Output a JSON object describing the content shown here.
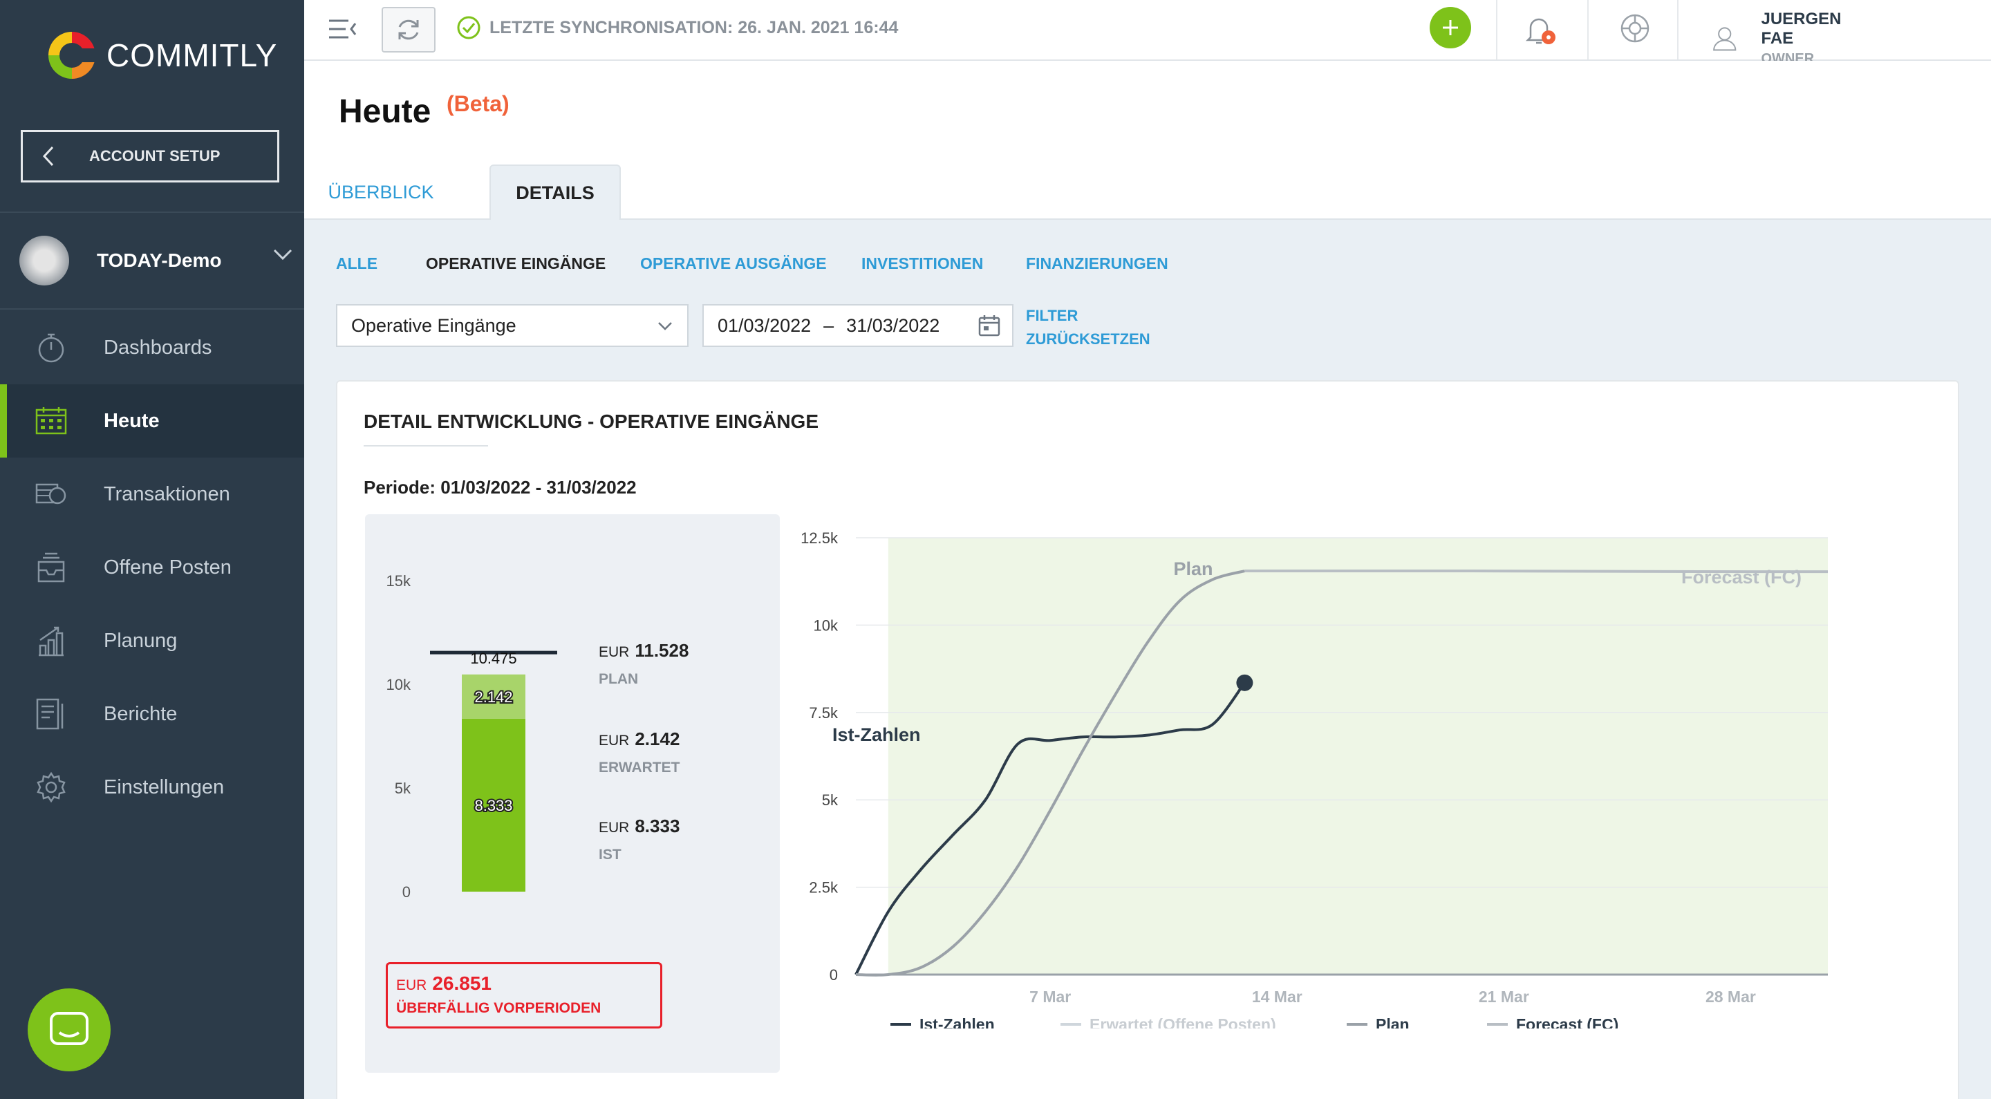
{
  "app": {
    "logo_text": "COMMITLY"
  },
  "sidebar": {
    "account_setup": "ACCOUNT SETUP",
    "company": "TODAY-Demo",
    "items": [
      {
        "label": "Dashboards",
        "icon": "stopwatch-icon"
      },
      {
        "label": "Heute",
        "icon": "calendar-grid-icon",
        "active": true
      },
      {
        "label": "Transaktionen",
        "icon": "coins-icon"
      },
      {
        "label": "Offene Posten",
        "icon": "inbox-tray-icon"
      },
      {
        "label": "Planung",
        "icon": "bar-chart-icon"
      },
      {
        "label": "Berichte",
        "icon": "report-icon"
      },
      {
        "label": "Einstellungen",
        "icon": "gear-icon"
      }
    ]
  },
  "topbar": {
    "sync_status": "LETZTE SYNCHRONISATION: 26. JAN. 2021 16:44",
    "user_name": "JUERGEN FAE",
    "user_role": "OWNER",
    "accent": "#7ec21a",
    "alert_color": "#f0623a"
  },
  "page": {
    "title": "Heute",
    "badge": "(Beta)",
    "tabs": [
      "ÜBERBLICK",
      "DETAILS"
    ],
    "active_tab": "DETAILS"
  },
  "filters": {
    "subtabs": [
      "ALLE",
      "OPERATIVE EINGÄNGE",
      "OPERATIVE AUSGÄNGE",
      "INVESTITIONEN",
      "FINANZIERUNGEN"
    ],
    "active_subtab": "OPERATIVE EINGÄNGE",
    "category_select": "Operative Eingänge",
    "date_from": "01/03/2022",
    "date_sep": "–",
    "date_to": "31/03/2022",
    "reset_line1": "FILTER",
    "reset_line2": "ZURÜCKSETZEN"
  },
  "card": {
    "title": "DETAIL ENTWICKLUNG - OPERATIVE EINGÄNGE",
    "period": "Periode: 01/03/2022 - 31/03/2022",
    "stats": [
      {
        "currency": "EUR",
        "value": "11.528",
        "label": "PLAN"
      },
      {
        "currency": "EUR",
        "value": "2.142",
        "label": "ERWARTET"
      },
      {
        "currency": "EUR",
        "value": "8.333",
        "label": "IST"
      }
    ],
    "overdue": {
      "currency": "EUR",
      "value": "26.851",
      "label": "ÜBERFÄLLIG VORPERIODEN"
    }
  },
  "chart_data": [
    {
      "type": "bar",
      "stacked": true,
      "categories": [
        ""
      ],
      "series": [
        {
          "name": "Ist",
          "values": [
            8333
          ],
          "label": "8.333",
          "color": "#7ec21a"
        },
        {
          "name": "Erwartet",
          "values": [
            2142
          ],
          "label": "2.142",
          "color": "#a8d46a"
        }
      ],
      "plan_marker": {
        "value": 11528,
        "label": "10.475"
      },
      "ylim": [
        0,
        15000
      ],
      "yticks": [
        0,
        5000,
        10000,
        15000
      ],
      "yticklabels": [
        "0",
        "5k",
        "10k",
        "15k"
      ]
    },
    {
      "type": "line",
      "x_axis": "date",
      "xlim": [
        "2022-03-01",
        "2022-03-31"
      ],
      "xticks": [
        "2022-03-07",
        "2022-03-14",
        "2022-03-21",
        "2022-03-28"
      ],
      "xticklabels": [
        "7 Mar",
        "14 Mar",
        "21 Mar",
        "28 Mar"
      ],
      "ylim": [
        0,
        12500
      ],
      "yticks": [
        0,
        2500,
        5000,
        7500,
        10000,
        12500
      ],
      "yticklabels": [
        "0",
        "2.5k",
        "5k",
        "7.5k",
        "10k",
        "12.5k"
      ],
      "shaded_region": [
        "2022-03-02",
        "2022-03-31"
      ],
      "series": [
        {
          "name": "Ist-Zahlen",
          "color": "#2c3b49",
          "x": [
            "2022-03-01",
            "2022-03-02",
            "2022-03-03",
            "2022-03-04",
            "2022-03-05",
            "2022-03-06",
            "2022-03-07",
            "2022-03-08",
            "2022-03-09",
            "2022-03-10",
            "2022-03-11",
            "2022-03-12",
            "2022-03-13"
          ],
          "y": [
            0,
            1800,
            3000,
            4000,
            5000,
            6600,
            6700,
            6800,
            6800,
            6850,
            7000,
            7150,
            8350
          ]
        },
        {
          "name": "Erwartet (Offene Posten)",
          "color": "#cfd6dc",
          "x": [],
          "y": []
        },
        {
          "name": "Plan",
          "color": "#9aa1a8",
          "x": [
            "2022-03-01",
            "2022-03-02",
            "2022-03-03",
            "2022-03-04",
            "2022-03-05",
            "2022-03-06",
            "2022-03-07",
            "2022-03-08",
            "2022-03-09",
            "2022-03-10",
            "2022-03-11",
            "2022-03-12",
            "2022-03-13"
          ],
          "y": [
            0,
            0,
            200,
            800,
            1800,
            3100,
            4700,
            6400,
            8000,
            9500,
            10700,
            11300,
            11550
          ]
        },
        {
          "name": "Forecast (FC)",
          "color": "#b8bec4",
          "x": [
            "2022-03-13",
            "2022-03-20",
            "2022-03-27",
            "2022-03-31"
          ],
          "y": [
            11550,
            11550,
            11530,
            11528
          ]
        }
      ],
      "annotations": [
        "Ist-Zahlen",
        "Plan",
        "Forecast (FC)"
      ]
    }
  ]
}
